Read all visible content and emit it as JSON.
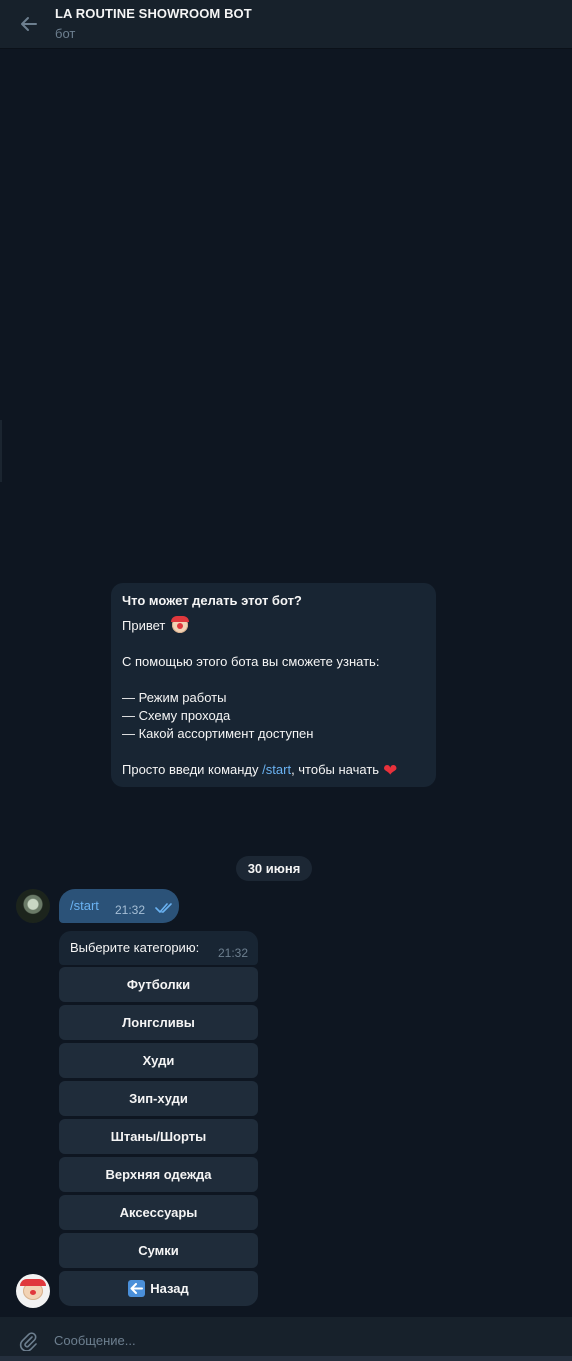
{
  "header": {
    "title": "LA ROUTINE SHOWROOM BOT",
    "subtitle": "бот"
  },
  "info_card": {
    "heading": "Что может делать этот бот?",
    "greeting": "Привет",
    "intro": "С помощью этого бота вы сможете узнать:",
    "items": [
      "— Режим работы",
      "— Схему прохода",
      "— Какой ассортимент доступен"
    ],
    "cta_prefix": "Просто введи команду",
    "cta_command": "/start",
    "cta_suffix": ", чтобы начать"
  },
  "date_separator": "30 июня",
  "outgoing": {
    "text": "/start",
    "time": "21:32"
  },
  "incoming": {
    "text": "Выберите категорию:",
    "time": "21:32"
  },
  "keyboard": [
    "Футболки",
    "Лонгсливы",
    "Худи",
    "Зип-худи",
    "Штаны/Шорты",
    "Верхняя одежда",
    "Аксессуары",
    "Сумки",
    "Назад"
  ],
  "composer": {
    "placeholder": "Сообщение..."
  },
  "colors": {
    "background": "#0e1621",
    "panel": "#17212b",
    "bubble_out": "#2b5278",
    "bubble_in": "#182533",
    "accent": "#6ab2f2"
  },
  "icons": [
    "back-arrow-icon",
    "double-check-icon",
    "paperclip-icon",
    "clown-emoji-icon",
    "heart-emoji-icon",
    "left-arrow-emoji-icon"
  ]
}
